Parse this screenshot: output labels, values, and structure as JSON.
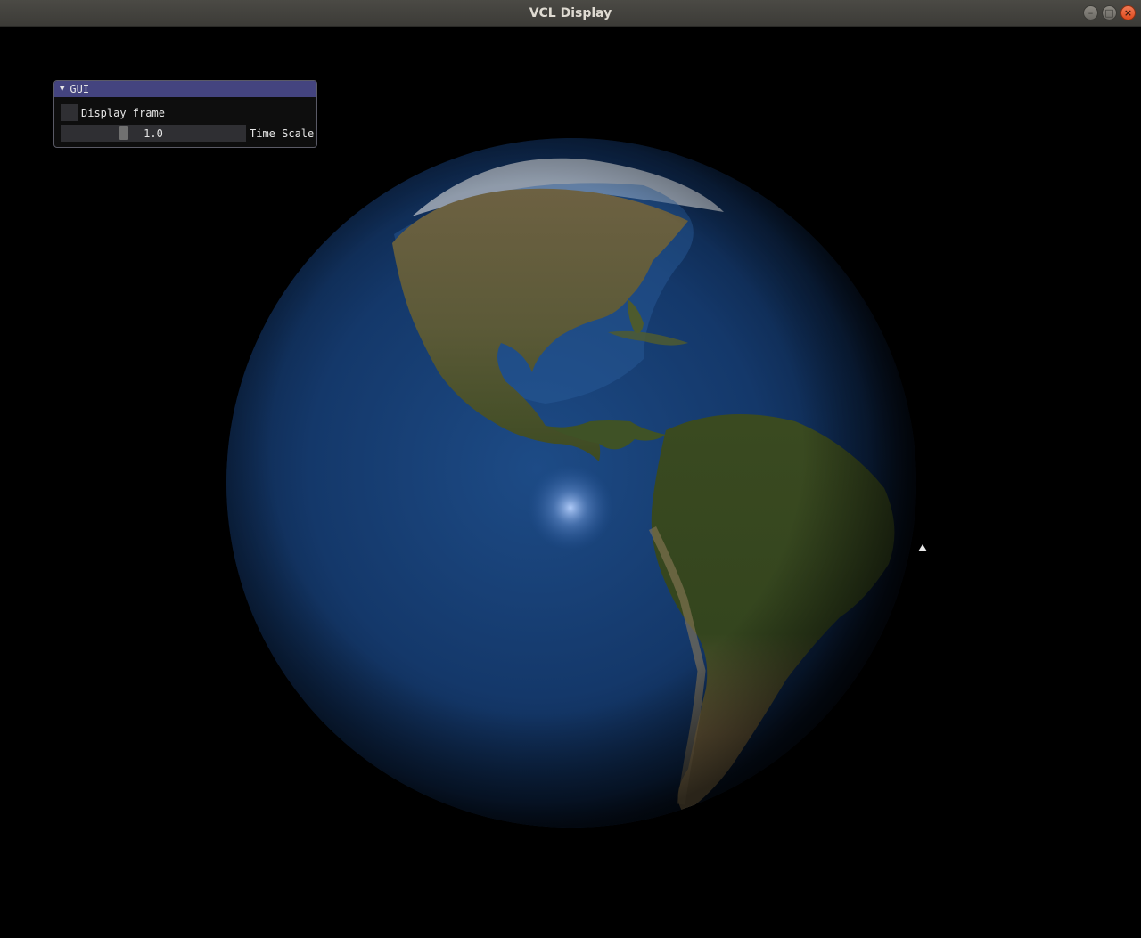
{
  "window": {
    "title": "VCL Display",
    "buttons": {
      "minimize": "–",
      "maximize": "□",
      "close": "×"
    }
  },
  "gui": {
    "header": "GUI",
    "collapse_arrow": "▼",
    "display_frame": {
      "label": "Display frame",
      "checked": false
    },
    "time_scale": {
      "label": "Time Scale",
      "value": "1.0",
      "value_fraction": 0.33
    }
  },
  "colors": {
    "title_bar": "#3c3b37",
    "gui_header": "#44447f",
    "gui_background": "#0f0f0f",
    "widget_background": "#2f2f33",
    "ocean": "#123a6a",
    "land": "#3c4a22",
    "sky": "#000000"
  },
  "icons": {
    "collapse": "triangle-down-icon",
    "cursor": "cursor-arrow-icon"
  }
}
